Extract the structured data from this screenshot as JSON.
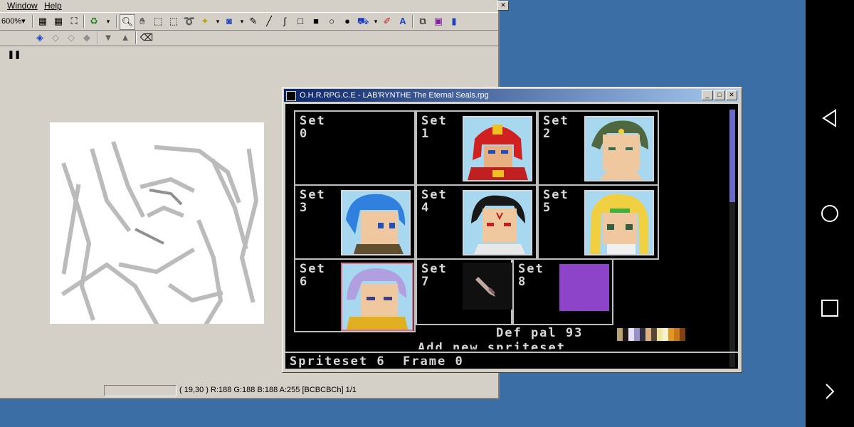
{
  "paint": {
    "menu": {
      "window": "Window",
      "help": "Help"
    },
    "zoom": "600%",
    "status": {
      "text": "( 19,30 ) R:188 G:188 B:188 A:255  [BCBCBCh]  1/1"
    }
  },
  "ohr": {
    "title": "O.H.R.RPG.C.E - LAB'RYNTHE The Eternal Seals.rpg",
    "sets": [
      {
        "label": "Set\n0"
      },
      {
        "label": "Set\n1"
      },
      {
        "label": "Set\n2"
      },
      {
        "label": "Set\n3"
      },
      {
        "label": "Set\n4"
      },
      {
        "label": "Set\n5"
      },
      {
        "label": "Set\n6"
      },
      {
        "label": "Set\n7"
      },
      {
        "label": "Set\n8"
      }
    ],
    "palette_label": "Def pal 93",
    "palette_colors": [
      "#b8a070",
      "#201818",
      "#e8e0f8",
      "#9890c8",
      "#303040",
      "#e0b080",
      "#584838",
      "#f0e8a0",
      "#f8f0d0",
      "#e09820",
      "#c87818",
      "#804010"
    ],
    "add_new": "Add new spriteset",
    "status_line": "Spriteset 6  Frame 0",
    "set8_color": "#8e44c8"
  },
  "colors": {
    "desktop": "#3a6ea5",
    "chrome": "#d4d0c8",
    "title_start": "#0a246a",
    "title_end": "#a6caf0"
  }
}
